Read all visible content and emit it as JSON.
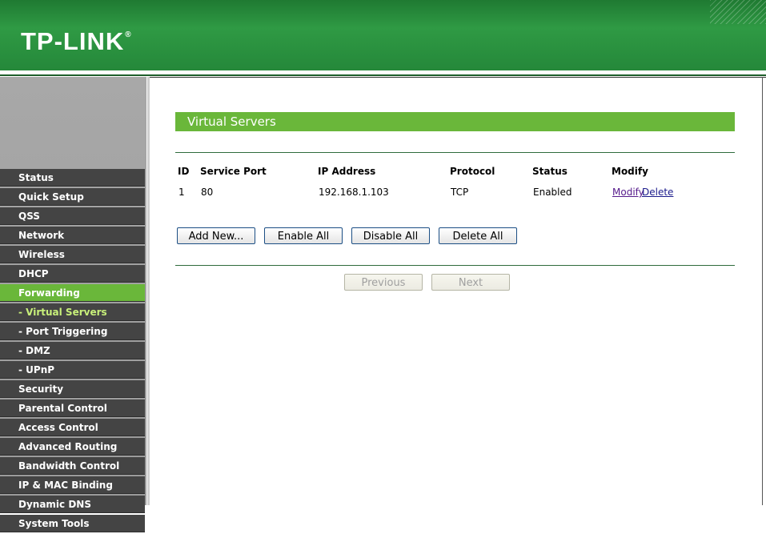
{
  "brand": {
    "logo_text": "TP-LINK",
    "logo_mark": "®"
  },
  "colors": {
    "header_green": "#2f9a44",
    "accent_green": "#6ab73a",
    "menu_dark": "#444444",
    "sidebar_gray": "#a8a8a8"
  },
  "sidebar": {
    "items": [
      {
        "label": "Status"
      },
      {
        "label": "Quick Setup"
      },
      {
        "label": "QSS"
      },
      {
        "label": "Network"
      },
      {
        "label": "Wireless"
      },
      {
        "label": "DHCP"
      },
      {
        "label": "Forwarding"
      },
      {
        "label": "- Virtual Servers"
      },
      {
        "label": "- Port Triggering"
      },
      {
        "label": "- DMZ"
      },
      {
        "label": "- UPnP"
      },
      {
        "label": "Security"
      },
      {
        "label": "Parental Control"
      },
      {
        "label": "Access Control"
      },
      {
        "label": "Advanced Routing"
      },
      {
        "label": "Bandwidth Control"
      },
      {
        "label": "IP & MAC Binding"
      },
      {
        "label": "Dynamic DNS"
      },
      {
        "label": "System Tools"
      }
    ]
  },
  "main": {
    "title": "Virtual Servers",
    "table": {
      "headers": {
        "id": "ID",
        "service_port": "Service Port",
        "ip": "IP Address",
        "protocol": "Protocol",
        "status": "Status",
        "modify": "Modify"
      },
      "rows": [
        {
          "id": "1",
          "service_port": "80",
          "ip": "192.168.1.103",
          "protocol": "TCP",
          "status": "Enabled",
          "modify_label": "Modify",
          "delete_label": "Delete"
        }
      ]
    },
    "buttons": {
      "add_new": "Add New...",
      "enable_all": "Enable All",
      "disable_all": "Disable All",
      "delete_all": "Delete All"
    },
    "pager": {
      "previous": "Previous",
      "next": "Next"
    }
  }
}
